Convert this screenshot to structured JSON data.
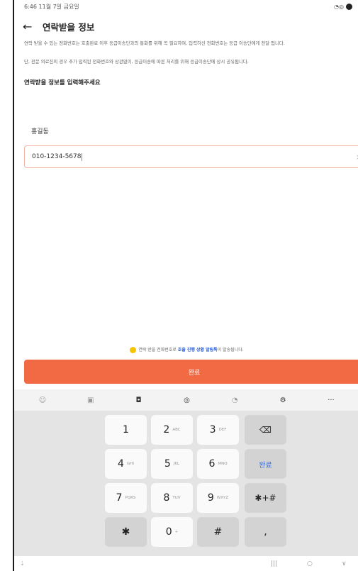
{
  "status_bar": {
    "time": "6:46  11월 7일 금요일"
  },
  "header": {
    "back_icon": "←",
    "title": "연락받을 정보"
  },
  "notice": {
    "paragraph1": "연락 받을 수 있는 전화번호는 호출완료 이후 응급이송단과의 통화를 위해 꼭 필요하며, 입력하신 전화번호는 응급 이송단에게 전달 됩니다.",
    "paragraph2": "단, 전문 의료진의 경우 추가 입력된 전화번호와 상관없이, 응급이송에 따른 처리를 위해 응급이송단에 상시 공유됩니다."
  },
  "form": {
    "section_title": "연락받을 정보를 입력해주세요",
    "name_value": "홍길동",
    "phone_value": "010-1234-5678",
    "clear_icon": "×"
  },
  "bottom_notice": {
    "prefix": "연락 받을 전화번호로 ",
    "highlight": "호출 진행 상황 알림톡",
    "suffix": "이 발송됩니다."
  },
  "complete_button": {
    "label": "완료"
  },
  "keyboard_toolbar": {
    "icons": [
      "☺",
      "▣",
      "◘",
      "◎",
      "◔",
      "⚙",
      "···"
    ]
  },
  "keyboard": {
    "keys": [
      {
        "main": "1",
        "sub": ""
      },
      {
        "main": "2",
        "sub": "ABC"
      },
      {
        "main": "3",
        "sub": "DEF"
      },
      {
        "main": "⌫",
        "sub": ""
      },
      {
        "main": "4",
        "sub": "GHI"
      },
      {
        "main": "5",
        "sub": "JKL"
      },
      {
        "main": "6",
        "sub": "MNO"
      },
      {
        "main": "완료",
        "sub": ""
      },
      {
        "main": "7",
        "sub": "PQRS"
      },
      {
        "main": "8",
        "sub": "TUV"
      },
      {
        "main": "9",
        "sub": "WXYZ"
      },
      {
        "main": "✱+#",
        "sub": ""
      },
      {
        "main": "✱",
        "sub": ""
      },
      {
        "main": "0",
        "sub": "+"
      },
      {
        "main": "#",
        "sub": ""
      },
      {
        "main": ",",
        "sub": ""
      }
    ]
  },
  "navbar": {
    "left_icon": "⇣",
    "recent": "|||",
    "home": "○",
    "back": "∨"
  },
  "colors": {
    "accent": "#f26a43",
    "link": "#2a5bd7",
    "badge": "#f5c400"
  }
}
